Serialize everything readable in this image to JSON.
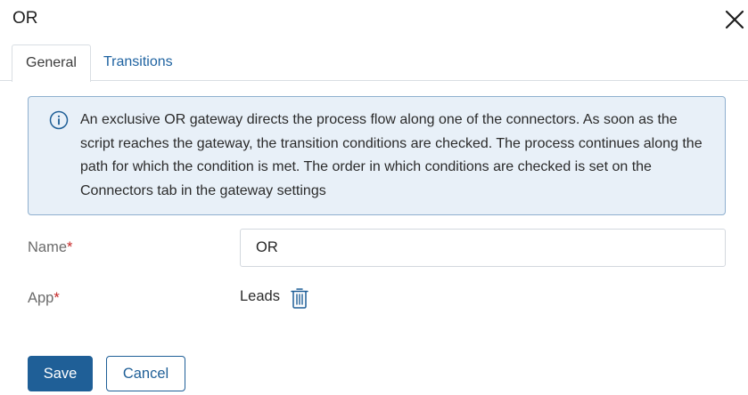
{
  "dialog": {
    "title": "OR",
    "close_icon": "close-icon"
  },
  "tabs": [
    {
      "label": "General",
      "active": true
    },
    {
      "label": "Transitions",
      "active": false
    }
  ],
  "info": {
    "icon": "info-icon",
    "text": "An exclusive OR gateway directs the process flow along one of the connectors. As soon as the script reaches the gateway, the transition conditions are checked. The process continues along the path for which the condition is met. The order in which conditions are checked is set on the Connectors tab in the gateway settings"
  },
  "form": {
    "name_label": "Name",
    "name_value": "OR",
    "app_label": "App",
    "app_value": "Leads",
    "required_mark": "*",
    "delete_icon": "trash-icon"
  },
  "buttons": {
    "save": "Save",
    "cancel": "Cancel"
  },
  "colors": {
    "accent": "#1f5f97",
    "info_bg": "#e8f0f8",
    "info_border": "#8fb0cf",
    "required": "#c62828"
  }
}
